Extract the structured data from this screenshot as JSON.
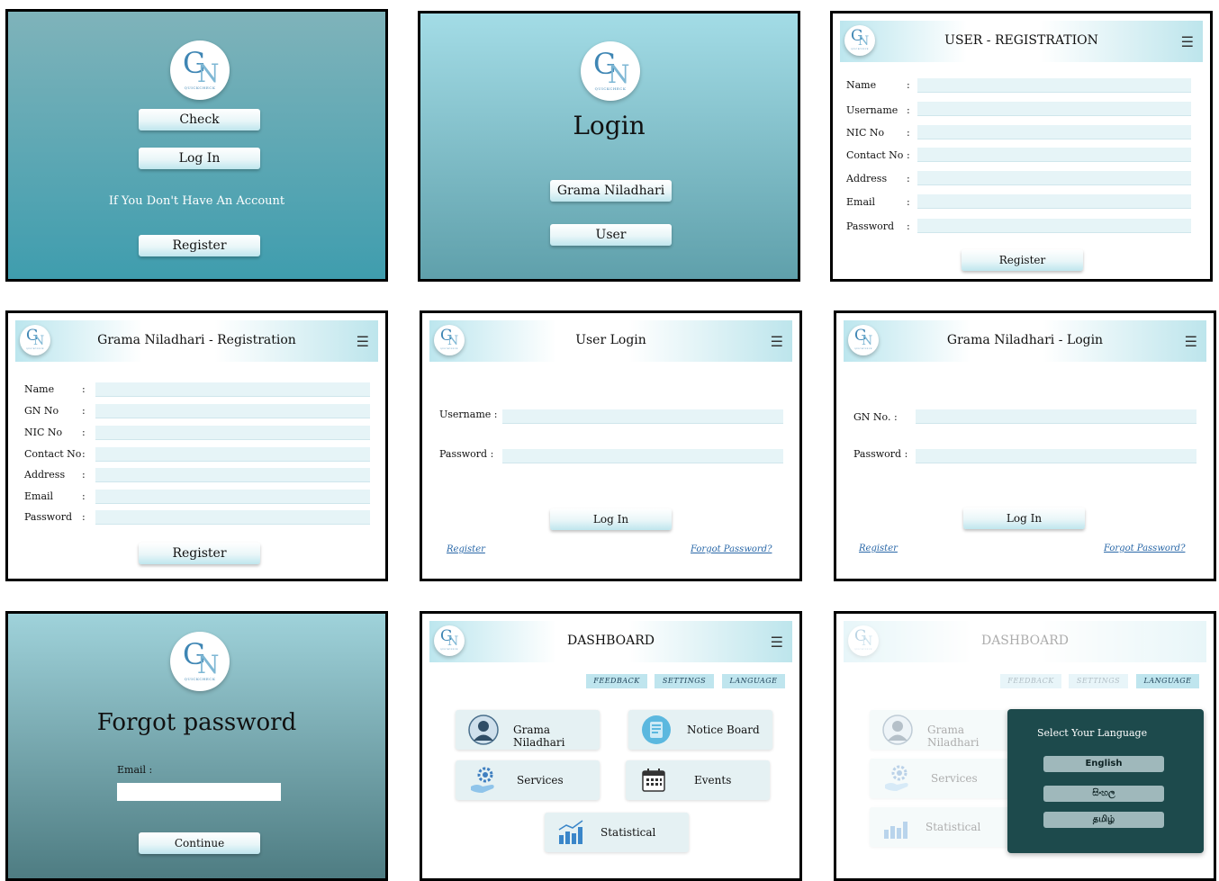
{
  "logo": {
    "g": "G",
    "n": "N",
    "tagline": "QUICKCHECK"
  },
  "welcome": {
    "check": "Check",
    "login": "Log In",
    "no_account": "If You Don't Have An Account",
    "register": "Register"
  },
  "login_select": {
    "title": "Login",
    "grama": "Grama Niladhari",
    "user": "User"
  },
  "user_reg": {
    "title": "USER - REGISTRATION",
    "fields": [
      "Name",
      "Username",
      "NIC No",
      "Contact No",
      "Address",
      "Email",
      "Password"
    ],
    "register": "Register"
  },
  "gn_reg": {
    "title": "Grama Niladhari - Registration",
    "fields": [
      "Name",
      "GN No",
      "NIC No",
      "Contact No",
      "Address",
      "Email",
      "Password"
    ],
    "register": "Register"
  },
  "user_login": {
    "title": "User Login",
    "username": "Username :",
    "password": "Password :",
    "login": "Log In",
    "register": "Register",
    "forgot": "Forgot Password?"
  },
  "gn_login": {
    "title": "Grama Niladhari - Login",
    "gn_no": "GN No. :",
    "password": "Password :",
    "login": "Log In",
    "register": "Register",
    "forgot": "Forgot Password?"
  },
  "forgot": {
    "title": "Forgot password",
    "email": "Email :",
    "continue": "Continue"
  },
  "dashboard": {
    "title": "DASHBOARD",
    "feedback": "FEEDBACK",
    "settings": "SETTINGS",
    "language": "LANGUAGE",
    "grama": "Grama Niladhari",
    "notice": "Notice Board",
    "services": "Services",
    "events": "Events",
    "statistical": "Statistical"
  },
  "lang": {
    "title": "Select Your Language",
    "options": [
      "English",
      "සිංහල",
      "தமிழ்"
    ]
  },
  "colors": {
    "accent": "#bfe5ee",
    "popup": "#1d4a4c"
  }
}
